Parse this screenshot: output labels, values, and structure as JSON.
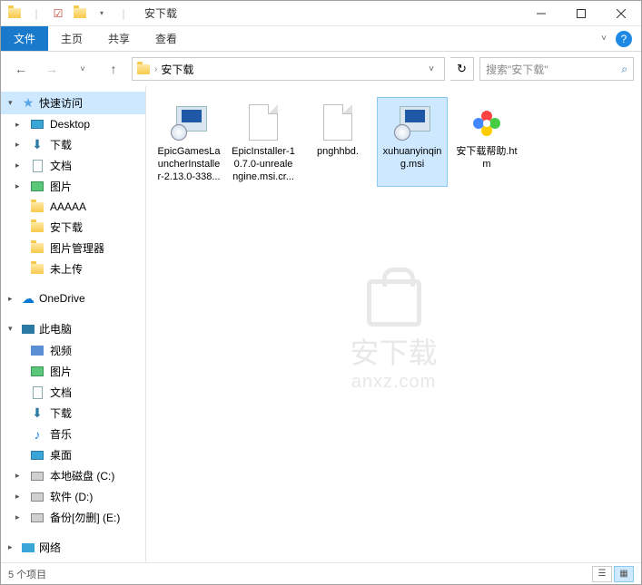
{
  "window": {
    "title": "安下载",
    "separator": "|"
  },
  "ribbon": {
    "tabs": [
      "文件",
      "主页",
      "共享",
      "查看"
    ],
    "active_index": 0
  },
  "breadcrumb": {
    "current": "安下载"
  },
  "search": {
    "placeholder": "搜索\"安下载\""
  },
  "sidebar": {
    "quick_access": "快速访问",
    "quick_items": [
      {
        "label": "Desktop",
        "type": "desktop"
      },
      {
        "label": "下载",
        "type": "download"
      },
      {
        "label": "文档",
        "type": "doc"
      },
      {
        "label": "图片",
        "type": "pic"
      },
      {
        "label": "AAAAA",
        "type": "folder"
      },
      {
        "label": "安下载",
        "type": "folder"
      },
      {
        "label": "图片管理器",
        "type": "folder"
      },
      {
        "label": "未上传",
        "type": "folder"
      }
    ],
    "onedrive": "OneDrive",
    "this_pc": "此电脑",
    "pc_items": [
      {
        "label": "视频",
        "type": "video"
      },
      {
        "label": "图片",
        "type": "pic"
      },
      {
        "label": "文档",
        "type": "doc"
      },
      {
        "label": "下载",
        "type": "download"
      },
      {
        "label": "音乐",
        "type": "music"
      },
      {
        "label": "桌面",
        "type": "desktop"
      },
      {
        "label": "本地磁盘 (C:)",
        "type": "disk"
      },
      {
        "label": "软件 (D:)",
        "type": "disk"
      },
      {
        "label": "备份[勿删] (E:)",
        "type": "disk"
      }
    ],
    "network": "网络"
  },
  "files": [
    {
      "name": "EpicGamesLauncherInstaller-2.13.0-338...",
      "type": "msi",
      "selected": false
    },
    {
      "name": "EpicInstaller-10.7.0-unrealengine.msi.cr...",
      "type": "blank",
      "selected": false
    },
    {
      "name": "pnghhbd.",
      "type": "blank",
      "selected": false
    },
    {
      "name": "xuhuanyinqing.msi",
      "type": "msi",
      "selected": true
    },
    {
      "name": "安下载帮助.htm",
      "type": "htm",
      "selected": false
    }
  ],
  "status": {
    "count_text": "5 个项目"
  },
  "watermark": {
    "line1": "安下载",
    "line2": "anxz.com"
  }
}
